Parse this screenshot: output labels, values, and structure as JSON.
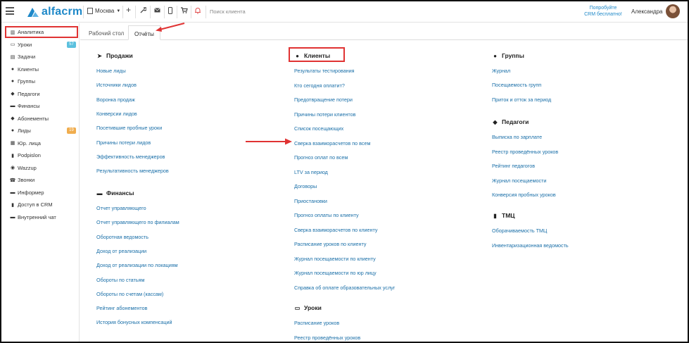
{
  "header": {
    "logo_text": "alfacrm",
    "city": "Москва",
    "search_placeholder": "Поиск клиента",
    "promo_line1": "Попробуйте",
    "promo_line2": "CRM бесплатно!",
    "user_name": "Александра"
  },
  "sidebar": {
    "items": [
      {
        "label": "Аналитика",
        "icon": "chart-icon"
      },
      {
        "label": "Уроки",
        "icon": "calendar-icon",
        "badge": "57",
        "badge_color": "#5bc0de"
      },
      {
        "label": "Задачи",
        "icon": "tasks-icon"
      },
      {
        "label": "Клиенты",
        "icon": "user-icon"
      },
      {
        "label": "Группы",
        "icon": "users-icon"
      },
      {
        "label": "Педагоги",
        "icon": "graduation-cap-icon"
      },
      {
        "label": "Финансы",
        "icon": "money-icon"
      },
      {
        "label": "Абонементы",
        "icon": "tag-icon"
      },
      {
        "label": "Лиды",
        "icon": "user-plus-icon",
        "badge": "19",
        "badge_color": "#f0ad4e"
      },
      {
        "label": "Юр. лица",
        "icon": "building-icon"
      },
      {
        "label": "Podpislon",
        "icon": "file-icon"
      },
      {
        "label": "Wazzup",
        "icon": "whatsapp-icon"
      },
      {
        "label": "Звонки",
        "icon": "phone-icon"
      },
      {
        "label": "Информер",
        "icon": "info-icon"
      },
      {
        "label": "Доступ в CRM",
        "icon": "lock-icon"
      },
      {
        "label": "Внутренний чат",
        "icon": "chat-icon"
      }
    ]
  },
  "tabs": [
    {
      "label": "Рабочий стол"
    },
    {
      "label": "Отчёты"
    }
  ],
  "sections": {
    "sales": {
      "title": "Продажи",
      "links": [
        "Новые лиды",
        "Источники лидов",
        "Воронка продаж",
        "Конверсии лидов",
        "Посетившие пробные уроки",
        "Причины потери лидов",
        "Эффективность менеджеров",
        "Результативность менеджеров"
      ]
    },
    "finance": {
      "title": "Финансы",
      "links": [
        "Отчет управляющего",
        "Отчет управляющего по филиалам",
        "Оборотная ведомость",
        "Доход от реализации",
        "Доход от реализации по локациям",
        "Обороты по статьям",
        "Обороты по счетам (кассам)",
        "Рейтинг абонементов",
        "История бонусных компенсаций"
      ]
    },
    "clients": {
      "title": "Клиенты",
      "links": [
        "Результаты тестирования",
        "Кто сегодня оплатит?",
        "Предотвращение потери",
        "Причины потери клиентов",
        "Список посещающих",
        "Сверка взаиморасчетов по всем",
        "Прогноз оплат по всем",
        "LTV за период",
        "Договоры",
        "Приостановки",
        "Прогноз оплаты по клиенту",
        "Сверка взаиморасчетов по клиенту",
        "Расписание уроков по клиенту",
        "Журнал посещаемости по клиенту",
        "Журнал посещаемости по юр лицу",
        "Справка об оплате образовательных услуг"
      ]
    },
    "lessons": {
      "title": "Уроки",
      "links": [
        "Расписание уроков",
        "Реестр проведённых уроков"
      ]
    },
    "groups": {
      "title": "Группы",
      "links": [
        "Журнал",
        "Посещаемость групп",
        "Приток и отток за период"
      ]
    },
    "teachers": {
      "title": "Педагоги",
      "links": [
        "Выписка по зарплате",
        "Реестр проведённых уроков",
        "Рейтинг педагогов",
        "Журнал посещаемости",
        "Конверсия пробных уроков"
      ]
    },
    "tmc": {
      "title": "ТМЦ",
      "links": [
        "Оборачиваемость ТМЦ",
        "Инвентаризационная ведомость"
      ]
    }
  }
}
